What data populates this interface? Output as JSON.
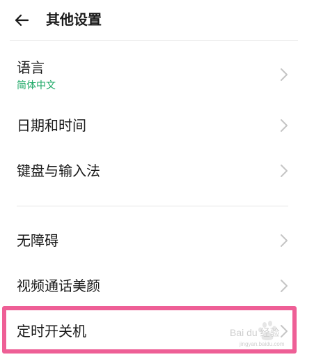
{
  "header": {
    "title": "其他设置",
    "back_icon": "arrow-left-icon"
  },
  "settings": {
    "language": {
      "label": "语言",
      "value": "简体中文"
    },
    "datetime": {
      "label": "日期和时间"
    },
    "keyboard": {
      "label": "键盘与输入法"
    },
    "accessibility": {
      "label": "无障碍"
    },
    "video_beauty": {
      "label": "视频通话美颜"
    },
    "scheduled_power": {
      "label": "定时开关机"
    }
  },
  "colors": {
    "accent_green": "#1aa764",
    "highlight_pink": "#ee5f96",
    "chevron": "#c4c4c4"
  },
  "watermark": {
    "text": "Bai du 经验",
    "url": "jingyan.baidu.com"
  }
}
